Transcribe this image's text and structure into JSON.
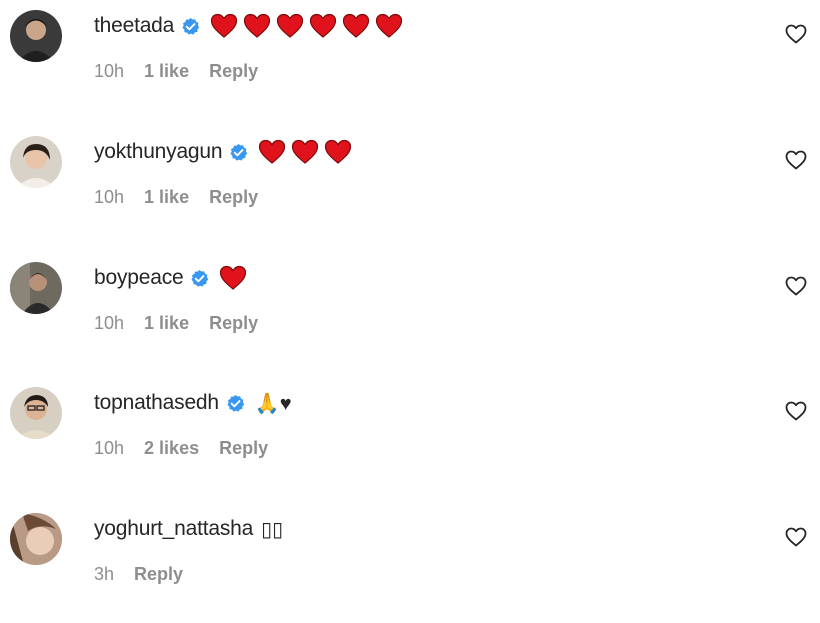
{
  "colors": {
    "text": "#262626",
    "meta": "#8e8e8e",
    "verified": "#3897f0",
    "heart": "#e0121c"
  },
  "comments": [
    {
      "username": "theetada",
      "verified": true,
      "text": "",
      "hearts": 6,
      "time": "10h",
      "likes": "1 like",
      "reply": "Reply"
    },
    {
      "username": "yokthunyagun",
      "verified": true,
      "text": "",
      "hearts": 3,
      "time": "10h",
      "likes": "1 like",
      "reply": "Reply"
    },
    {
      "username": "boypeace",
      "verified": true,
      "text": "",
      "hearts": 1,
      "time": "10h",
      "likes": "1 like",
      "reply": "Reply"
    },
    {
      "username": "topnathasedh",
      "verified": true,
      "text": "🙏♥",
      "hearts": 0,
      "time": "10h",
      "likes": "2 likes",
      "reply": "Reply"
    },
    {
      "username": "yoghurt_nattasha",
      "verified": false,
      "text": "▯▯",
      "hearts": 0,
      "time": "3h",
      "likes": "",
      "reply": "Reply"
    }
  ],
  "icons": {
    "verified": "verified-badge-icon",
    "like": "heart-outline-icon",
    "emoji": "red-heart-emoji"
  }
}
